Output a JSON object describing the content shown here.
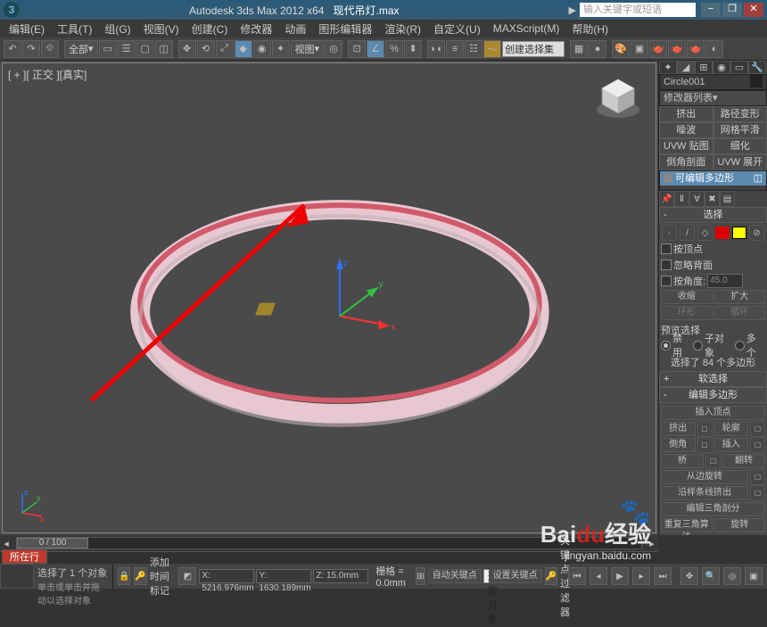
{
  "title": {
    "app": "Autodesk 3ds Max 2012 x64",
    "file": "现代吊灯.max",
    "search_placeholder": "输入关键字或短语"
  },
  "menu": [
    "编辑(E)",
    "工具(T)",
    "组(G)",
    "视图(V)",
    "创建(C)",
    "修改器",
    "动画",
    "图形编辑器",
    "渲染(R)",
    "自定义(U)",
    "MAXScript(M)",
    "帮助(H)"
  ],
  "toolbar": {
    "dropdown_all": "全部",
    "dropdown_view": "视图",
    "create_selection": "创建选择集"
  },
  "viewport": {
    "label": "[ + ][ 正交 ][真实]"
  },
  "right": {
    "object_name": "Circle001",
    "modifier_list": "修改器列表",
    "btns": [
      [
        "挤出",
        "路径变形"
      ],
      [
        "噪波",
        "网格平滑"
      ],
      [
        "UVW 贴图",
        "细化"
      ],
      [
        "倒角剖面",
        "UVW 展开"
      ]
    ],
    "stack_item": "可编辑多边形",
    "sections": {
      "selection": "选择",
      "soft": "软选择",
      "editpoly": "编辑多边形",
      "sel_byvertex": "按顶点",
      "sel_ignore": "忽略背面",
      "sel_byangle": "按角度:",
      "angle_val": "45.0",
      "shrink": "收缩",
      "grow": "扩大",
      "ring": "环形",
      "loop": "循环",
      "preview": "预览选择",
      "pv_off": "禁用",
      "pv_sub": "子对象",
      "pv_multi": "多个",
      "selected": "选择了 84 个多边形",
      "insert_vert": "插入顶点",
      "extrude": "挤出",
      "outline": "轮廓",
      "bevel": "倒角",
      "inset": "插入",
      "bridge": "桥",
      "flip": "翻转",
      "from_edge": "从边旋转",
      "along_spline": "沿样条线挤出",
      "edit_tri": "编辑三角剖分",
      "retri": "重复三角算法",
      "turn": "旋转"
    }
  },
  "timeline": {
    "frame": "0 / 100"
  },
  "status": {
    "tab": "所在行",
    "msg1": "选择了 1 个对象",
    "msg2": "单击或单击并拖动以选择对象",
    "add_key": "添加时间标记",
    "x": "X: 5216.976mm",
    "y": "Y: 1630.189mm",
    "z": "Z: 15.0mm",
    "grid": "栅格 = 0.0mm",
    "autokey": "自动关键点",
    "setkey": "设置关键点",
    "keyfilter": "关键点过滤器",
    "dropdown": "选定对象"
  },
  "watermark": {
    "brand": "Bai",
    "du": "du",
    "exp": "经验",
    "url": "jingyan.baidu.com"
  }
}
